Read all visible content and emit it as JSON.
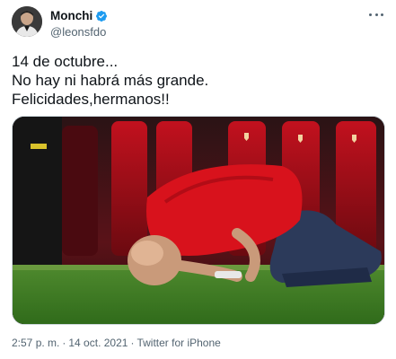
{
  "author": {
    "display_name": "Monchi",
    "handle": "@leonsfdo",
    "verified": true,
    "avatar_icon": "profile-photo"
  },
  "tweet": {
    "lines": [
      "14 de octubre...",
      "No hay ni habrá más grande.",
      "Felicidades,hermanos!!"
    ]
  },
  "media": {
    "type": "photo"
  },
  "meta": {
    "time": "2:57 p. m.",
    "separator": "·",
    "date": "14 oct. 2021",
    "source": "Twitter for iPhone"
  },
  "icons": {
    "more": "more-horizontal-icon",
    "verified": "verified-badge-icon"
  },
  "colors": {
    "text": "#0f1419",
    "secondary": "#536471",
    "verified_blue": "#1d9bf0"
  }
}
